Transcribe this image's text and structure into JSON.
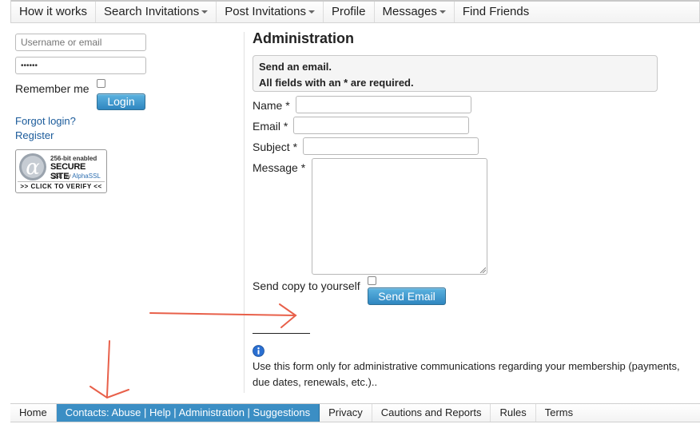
{
  "topnav": {
    "items": [
      {
        "label": "How it works",
        "dropdown": false
      },
      {
        "label": "Search Invitations",
        "dropdown": true
      },
      {
        "label": "Post Invitations",
        "dropdown": true
      },
      {
        "label": "Profile",
        "dropdown": false
      },
      {
        "label": "Messages",
        "dropdown": true
      },
      {
        "label": "Find Friends",
        "dropdown": false
      }
    ]
  },
  "login": {
    "username_placeholder": "Username or email",
    "password_value": "••••••",
    "remember_label": "Remember me",
    "login_button": "Login",
    "forgot_link": "Forgot login?",
    "register_link": "Register"
  },
  "ssl_badge": {
    "line1": "256-bit enabled",
    "line2": "SECURE SITE",
    "line3_prefix": "SSL by ",
    "line3_brand": "AlphaSSL",
    "verify": ">> CLICK TO VERIFY <<"
  },
  "form": {
    "heading": "Administration",
    "notice_line1": "Send an email.",
    "notice_line2": "All fields with an * are required.",
    "name_label": "Name *",
    "email_label": "Email *",
    "subject_label": "Subject *",
    "message_label": "Message *",
    "copy_label": "Send copy to yourself",
    "send_button": "Send Email",
    "info_text": "Use this form only for administrative communications regarding your membership (payments, due dates, renewals, etc.).."
  },
  "footer": {
    "items": [
      {
        "label": "Home",
        "active": false
      },
      {
        "label": "Contacts: Abuse | Help | Administration | Suggestions",
        "active": true
      },
      {
        "label": "Privacy",
        "active": false
      },
      {
        "label": "Cautions and Reports",
        "active": false
      },
      {
        "label": "Rules",
        "active": false
      },
      {
        "label": "Terms",
        "active": false
      }
    ]
  },
  "colors": {
    "accent": "#3b8ec4",
    "arrow": "#e8604a",
    "link": "#1a5a9a"
  }
}
